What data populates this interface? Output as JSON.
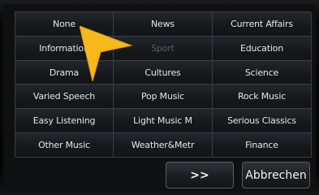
{
  "genres": [
    {
      "label": "None",
      "enabled": true
    },
    {
      "label": "News",
      "enabled": true
    },
    {
      "label": "Current Affairs",
      "enabled": true
    },
    {
      "label": "Information",
      "enabled": true
    },
    {
      "label": "Sport",
      "enabled": false
    },
    {
      "label": "Education",
      "enabled": true
    },
    {
      "label": "Drama",
      "enabled": true
    },
    {
      "label": "Cultures",
      "enabled": true
    },
    {
      "label": "Science",
      "enabled": true
    },
    {
      "label": "Varied Speech",
      "enabled": true
    },
    {
      "label": "Pop Music",
      "enabled": true
    },
    {
      "label": "Rock Music",
      "enabled": true
    },
    {
      "label": "Easy Listening",
      "enabled": true
    },
    {
      "label": "Light Music M",
      "enabled": true
    },
    {
      "label": "Serious Classics",
      "enabled": true
    },
    {
      "label": "Other Music",
      "enabled": true
    },
    {
      "label": "Weather&Metr",
      "enabled": true
    },
    {
      "label": "Finance",
      "enabled": true
    }
  ],
  "buttons": {
    "next_label": ">>",
    "cancel_label": "Abbrechen"
  },
  "colors": {
    "cursor": "#f7b81c",
    "text": "#e4e6e8",
    "text_disabled": "#5c6065"
  },
  "icons": {
    "pointer": "arrow-pointer-icon"
  }
}
